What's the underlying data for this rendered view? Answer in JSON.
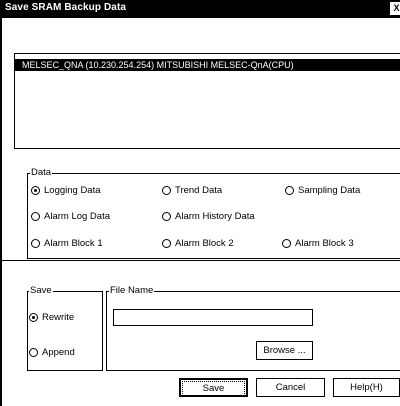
{
  "window": {
    "title": "Save SRAM Backup Data",
    "close_glyph": "X"
  },
  "list": {
    "items": [
      "MELSEC_QNA (10.230.254.254) MITSUBISHI MELSEC-QnA(CPU)"
    ],
    "selected_index": 0
  },
  "data_group": {
    "legend": "Data",
    "options": [
      {
        "label": "Logging Data",
        "selected": true
      },
      {
        "label": "Trend Data",
        "selected": false
      },
      {
        "label": "Sampling Data",
        "selected": false
      },
      {
        "label": "Alarm Log Data",
        "selected": false
      },
      {
        "label": "Alarm History Data",
        "selected": false
      },
      {
        "label": "Alarm Block 1",
        "selected": false
      },
      {
        "label": "Alarm Block 2",
        "selected": false
      },
      {
        "label": "Alarm Block 3",
        "selected": false
      }
    ]
  },
  "save_group": {
    "legend": "Save",
    "options": [
      {
        "label": "Rewrite",
        "selected": true
      },
      {
        "label": "Append",
        "selected": false
      }
    ]
  },
  "file_group": {
    "legend": "File Name",
    "value": "",
    "browse_label": "Browse ..."
  },
  "buttons": {
    "save": "Save",
    "cancel": "Cancel",
    "help": "Help(H)"
  }
}
